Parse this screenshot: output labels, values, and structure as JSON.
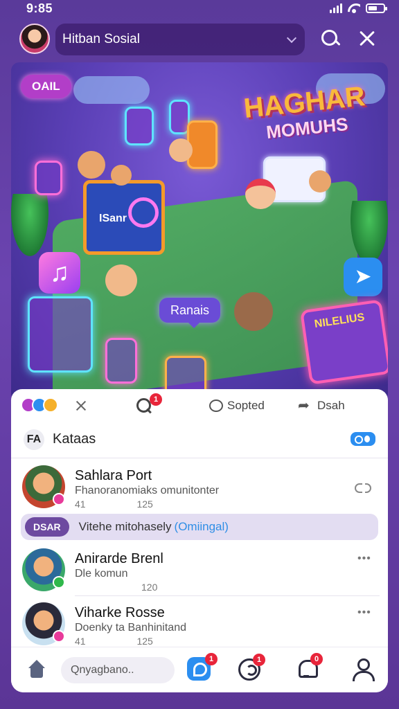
{
  "status_bar": {
    "time": "9:85"
  },
  "header": {
    "app_name": "Hitban Sosial"
  },
  "hero": {
    "chip_label": "OAIL",
    "title_line1": "HAGHAR",
    "title_line2": "MOMUHS",
    "monitor_label": "ISanr",
    "bubble_label": "Ranais",
    "board_title": "NILELIUS"
  },
  "actions": {
    "zoom_badge": "1",
    "comment_label": "Sopted",
    "share_label": "Dsah"
  },
  "section": {
    "icon_text": "FA",
    "title": "Kataas"
  },
  "feed": [
    {
      "name": "Sahlara Port",
      "text": "Fhanoranomiaks omunitonter",
      "meta_left": "41",
      "meta_count": "125"
    },
    {
      "name": "Anirarde Brenl",
      "text": "Dle komun",
      "meta_left": "",
      "meta_count": "120"
    },
    {
      "name": "Viharke Rosse",
      "text": "Doenky ta Banhinitand",
      "meta_left": "41",
      "meta_count": "125"
    }
  ],
  "promo": {
    "chip_label": "DSAR",
    "text": "Vitehe mitohasely",
    "accent": "(Omiingal)"
  },
  "bottom_nav": {
    "search_placeholder": "Qnyagbano..",
    "tile_badge": "1",
    "chat_badge": "1",
    "bell_badge": "0"
  },
  "colors": {
    "background": "#5a3a9a",
    "accent_blue": "#2b8ef0",
    "badge_red": "#e8253a",
    "promo_purple": "#6d4aa0"
  }
}
